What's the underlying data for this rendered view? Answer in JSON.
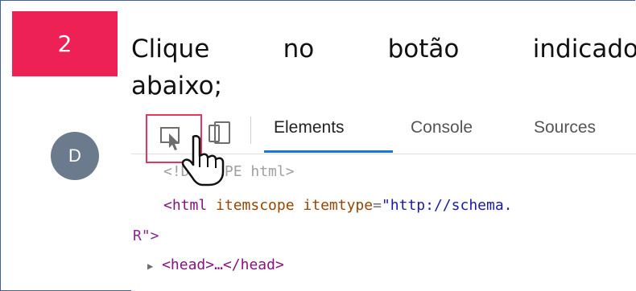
{
  "step": {
    "number": "2",
    "color": "#ee2157"
  },
  "instruction": {
    "words_line1": [
      "Clique",
      "no",
      "botão",
      "indicado"
    ],
    "line2": "abaixo;"
  },
  "avatar": {
    "letter": "D"
  },
  "devtools": {
    "tabs": {
      "elements": "Elements",
      "console": "Console",
      "sources": "Sources"
    },
    "code": {
      "doctype": "<!DOCTYPE html>",
      "html_open_tag": "<html",
      "attr1": " itemscope",
      "attr2": " itemtype",
      "eq": "=",
      "attr2_val": "\"http://schema.",
      "wrap": "R\">",
      "head": "<head>…</head>"
    },
    "icons": [
      "inspect-element-icon",
      "device-toolbar-icon",
      "pointer-hand-icon"
    ],
    "accent": "#1a73e8",
    "highlight": "#e6365f"
  }
}
